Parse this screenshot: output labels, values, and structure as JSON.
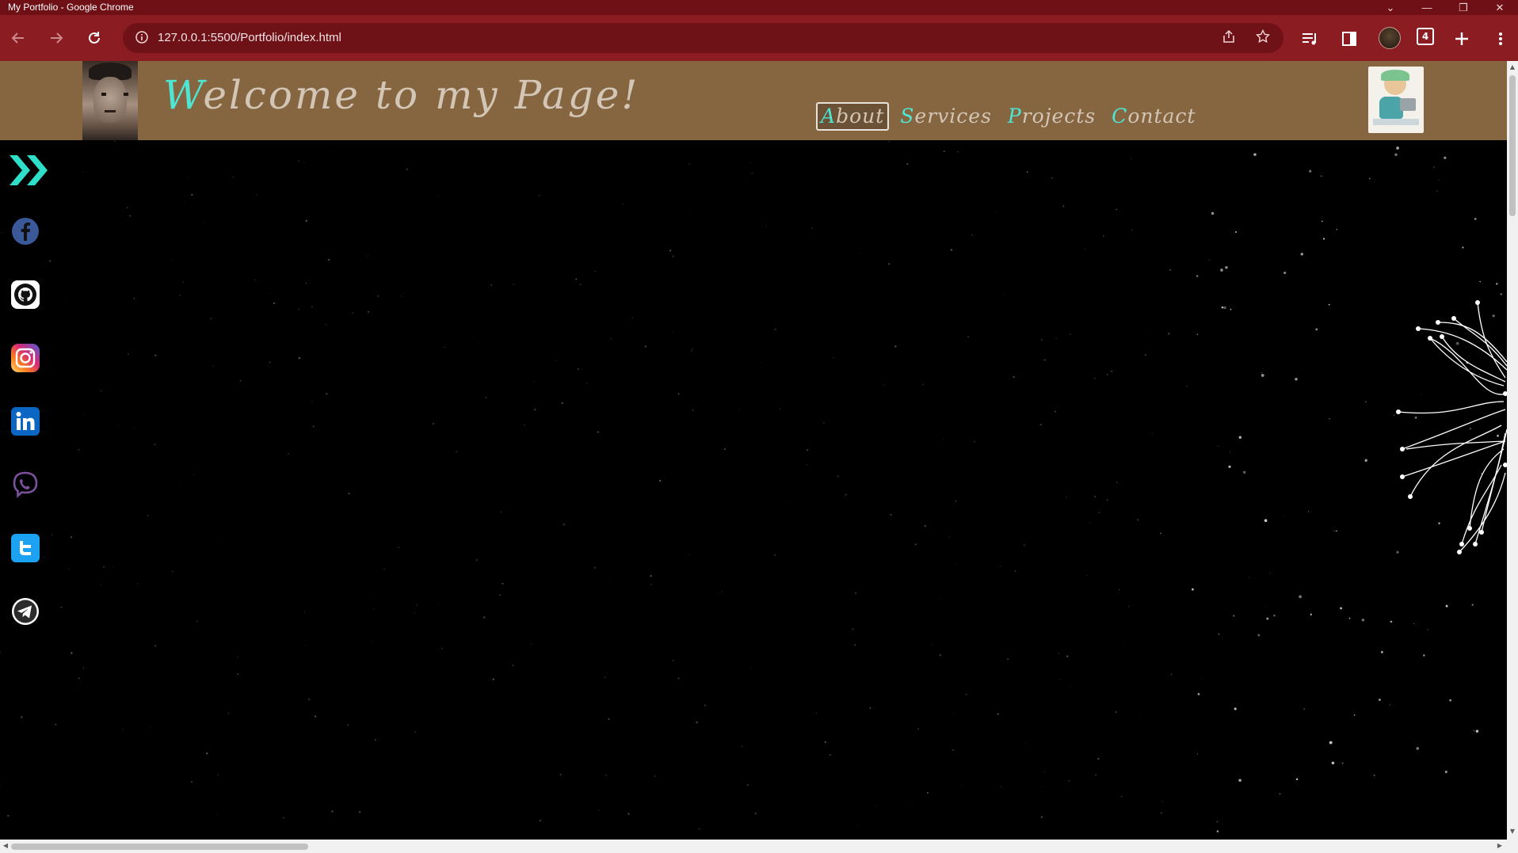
{
  "window": {
    "title": "My Portfolio - Google Chrome",
    "controls": [
      "⌄",
      "—",
      "❐",
      "✕"
    ]
  },
  "browser": {
    "url": "127.0.0.1:5500/Portfolio/index.html",
    "tab_count": "4"
  },
  "page": {
    "welcome_first": "W",
    "welcome_rest": "elcome to my Page!",
    "nav": [
      {
        "first": "A",
        "rest": "bout",
        "active": true
      },
      {
        "first": "S",
        "rest": "ervices",
        "active": false
      },
      {
        "first": "P",
        "rest": "rojects",
        "active": false
      },
      {
        "first": "C",
        "rest": "ontact",
        "active": false
      }
    ],
    "accent_color": "#4ee6d3",
    "header_color": "#856641",
    "social_icons": [
      "facebook-icon",
      "github-icon",
      "instagram-icon",
      "linkedin-icon",
      "viber-icon",
      "twitter-icon",
      "telegram-icon"
    ]
  }
}
